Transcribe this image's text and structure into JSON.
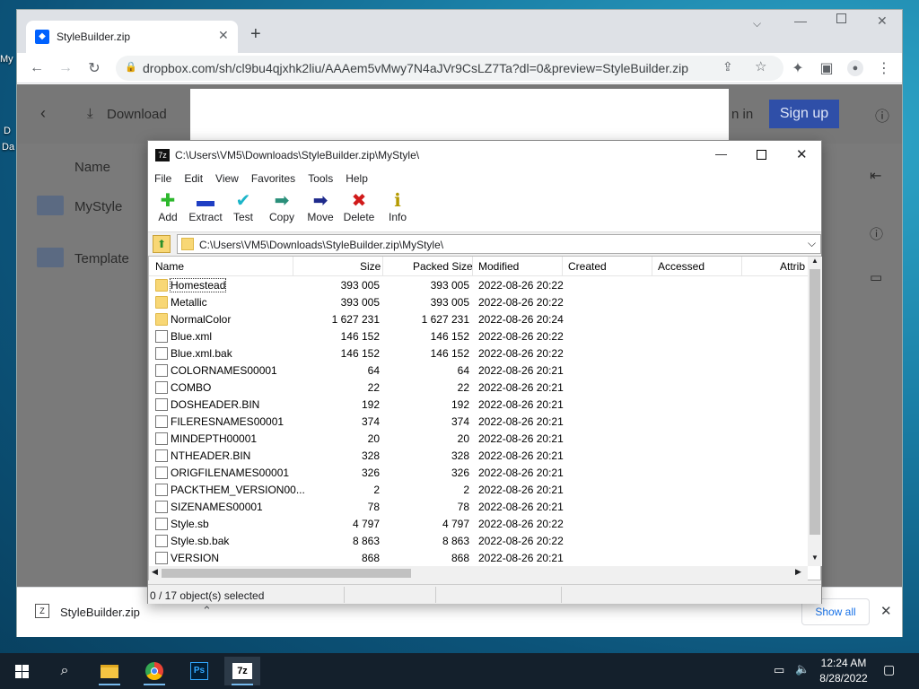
{
  "desktop": {
    "edge_labels": [
      "My",
      "D",
      "Da"
    ]
  },
  "browser": {
    "tab_title": "StyleBuilder.zip",
    "url": "dropbox.com/sh/cl9bu4qjxhk2liu/AAAem5vMwy7N4aJVr9CsLZ7Ta?dl=0&preview=StyleBuilder.zip",
    "icons": [
      "back-icon",
      "forward-icon",
      "reload-icon",
      "lock-icon",
      "share-icon",
      "star-icon",
      "extensions-icon",
      "sidepanel-icon",
      "profile-icon",
      "menu-icon"
    ]
  },
  "dropbox": {
    "download_label": "Download",
    "signin_label": "n in",
    "signup_label": "Sign up",
    "column_name": "Name",
    "folders": [
      "MyStyle",
      "Template"
    ]
  },
  "zip": {
    "title": "C:\\Users\\VM5\\Downloads\\StyleBuilder.zip\\MyStyle\\",
    "menu": [
      "File",
      "Edit",
      "View",
      "Favorites",
      "Tools",
      "Help"
    ],
    "toolbar": [
      {
        "label": "Add",
        "icon": "add-icon",
        "glyph": "✚",
        "color": "#2db82d"
      },
      {
        "label": "Extract",
        "icon": "extract-icon",
        "glyph": "▬",
        "color": "#1f3fc4"
      },
      {
        "label": "Test",
        "icon": "test-icon",
        "glyph": "✔",
        "color": "#1cb5c9"
      },
      {
        "label": "Copy",
        "icon": "copy-icon",
        "glyph": "➡",
        "color": "#2a8f7a"
      },
      {
        "label": "Move",
        "icon": "move-icon",
        "glyph": "➡",
        "color": "#1e2a8c"
      },
      {
        "label": "Delete",
        "icon": "delete-icon",
        "glyph": "✖",
        "color": "#d11a1a"
      },
      {
        "label": "Info",
        "icon": "info-icon",
        "glyph": "ℹ",
        "color": "#b59a00"
      }
    ],
    "path": "C:\\Users\\VM5\\Downloads\\StyleBuilder.zip\\MyStyle\\",
    "columns": [
      "Name",
      "Size",
      "Packed Size",
      "Modified",
      "Created",
      "Accessed",
      "Attrib"
    ],
    "rows": [
      {
        "name": "Homestead",
        "type": "folder",
        "size": "393 005",
        "packed": "393 005",
        "modified": "2022-08-26 20:22"
      },
      {
        "name": "Metallic",
        "type": "folder",
        "size": "393 005",
        "packed": "393 005",
        "modified": "2022-08-26 20:22"
      },
      {
        "name": "NormalColor",
        "type": "folder",
        "size": "1 627 231",
        "packed": "1 627 231",
        "modified": "2022-08-26 20:24"
      },
      {
        "name": "Blue.xml",
        "type": "file",
        "size": "146 152",
        "packed": "146 152",
        "modified": "2022-08-26 20:22"
      },
      {
        "name": "Blue.xml.bak",
        "type": "file",
        "size": "146 152",
        "packed": "146 152",
        "modified": "2022-08-26 20:22"
      },
      {
        "name": "COLORNAMES00001",
        "type": "file",
        "size": "64",
        "packed": "64",
        "modified": "2022-08-26 20:21"
      },
      {
        "name": "COMBO",
        "type": "file",
        "size": "22",
        "packed": "22",
        "modified": "2022-08-26 20:21"
      },
      {
        "name": "DOSHEADER.BIN",
        "type": "file",
        "size": "192",
        "packed": "192",
        "modified": "2022-08-26 20:21"
      },
      {
        "name": "FILERESNAMES00001",
        "type": "file",
        "size": "374",
        "packed": "374",
        "modified": "2022-08-26 20:21"
      },
      {
        "name": "MINDEPTH00001",
        "type": "file",
        "size": "20",
        "packed": "20",
        "modified": "2022-08-26 20:21"
      },
      {
        "name": "NTHEADER.BIN",
        "type": "file",
        "size": "328",
        "packed": "328",
        "modified": "2022-08-26 20:21"
      },
      {
        "name": "ORIGFILENAMES00001",
        "type": "file",
        "size": "326",
        "packed": "326",
        "modified": "2022-08-26 20:21"
      },
      {
        "name": "PACKTHEM_VERSION00...",
        "type": "file",
        "size": "2",
        "packed": "2",
        "modified": "2022-08-26 20:21"
      },
      {
        "name": "SIZENAMES00001",
        "type": "file",
        "size": "78",
        "packed": "78",
        "modified": "2022-08-26 20:21"
      },
      {
        "name": "Style.sb",
        "type": "file",
        "size": "4 797",
        "packed": "4 797",
        "modified": "2022-08-26 20:22"
      },
      {
        "name": "Style.sb.bak",
        "type": "file",
        "size": "8 863",
        "packed": "8 863",
        "modified": "2022-08-26 20:22"
      },
      {
        "name": "VERSION",
        "type": "file",
        "size": "868",
        "packed": "868",
        "modified": "2022-08-26 20:21"
      }
    ],
    "status": "0 / 17 object(s) selected"
  },
  "download_bar": {
    "file_name": "StyleBuilder.zip",
    "show_all_label": "Show all"
  },
  "taskbar": {
    "time": "12:24 AM",
    "date": "8/28/2022",
    "apps": [
      "start-icon",
      "search-icon",
      "file-explorer-icon",
      "chrome-icon",
      "photoshop-icon",
      "7zip-icon"
    ]
  }
}
